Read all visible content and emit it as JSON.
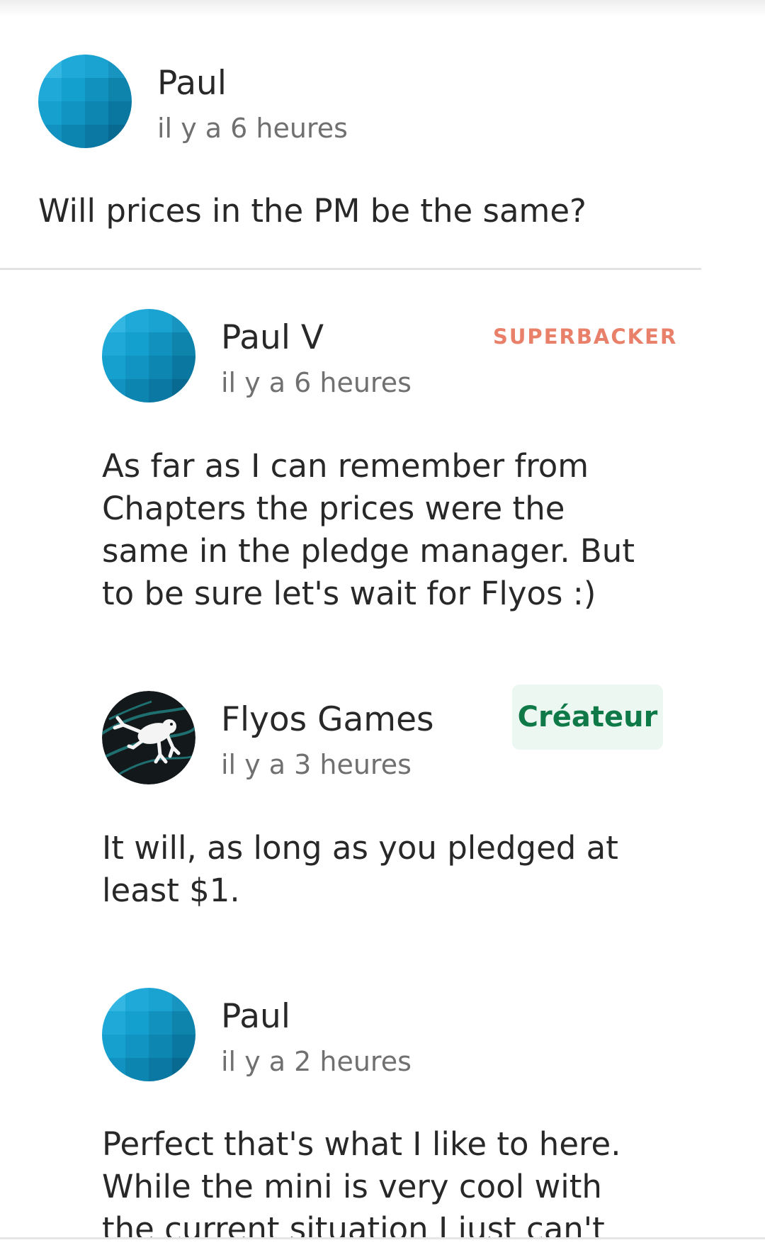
{
  "comments": [
    {
      "author": "Paul",
      "time": "il y a 6 heures",
      "body": "Will prices in the PM be the same?",
      "avatar_icon": "blue-grid-avatar-icon"
    },
    {
      "author": "Paul V",
      "time": "il y a 6 heures",
      "badge": "SUPERBACKER",
      "body": "As far as I can remember from Chapters the prices were the same in the pledge manager. But to be sure let's wait for Flyos :)",
      "avatar_icon": "blue-grid-avatar-icon"
    },
    {
      "author": "Flyos Games",
      "time": "il y a 3 heures",
      "badge": "Créateur",
      "body": "It will, as long as you pledged at least $1.",
      "avatar_icon": "frog-logo-avatar-icon"
    },
    {
      "author": "Paul",
      "time": "il y a 2 heures",
      "body": "Perfect that's what I like to here. While the mini is very cool with the current situation I just can't justify",
      "avatar_icon": "blue-grid-avatar-icon"
    }
  ],
  "colors": {
    "superbacker": "#e9806a",
    "creator_text": "#0f7a48",
    "creator_bg": "#ecf7f2",
    "avatar_blue": "#1ba3d3"
  }
}
